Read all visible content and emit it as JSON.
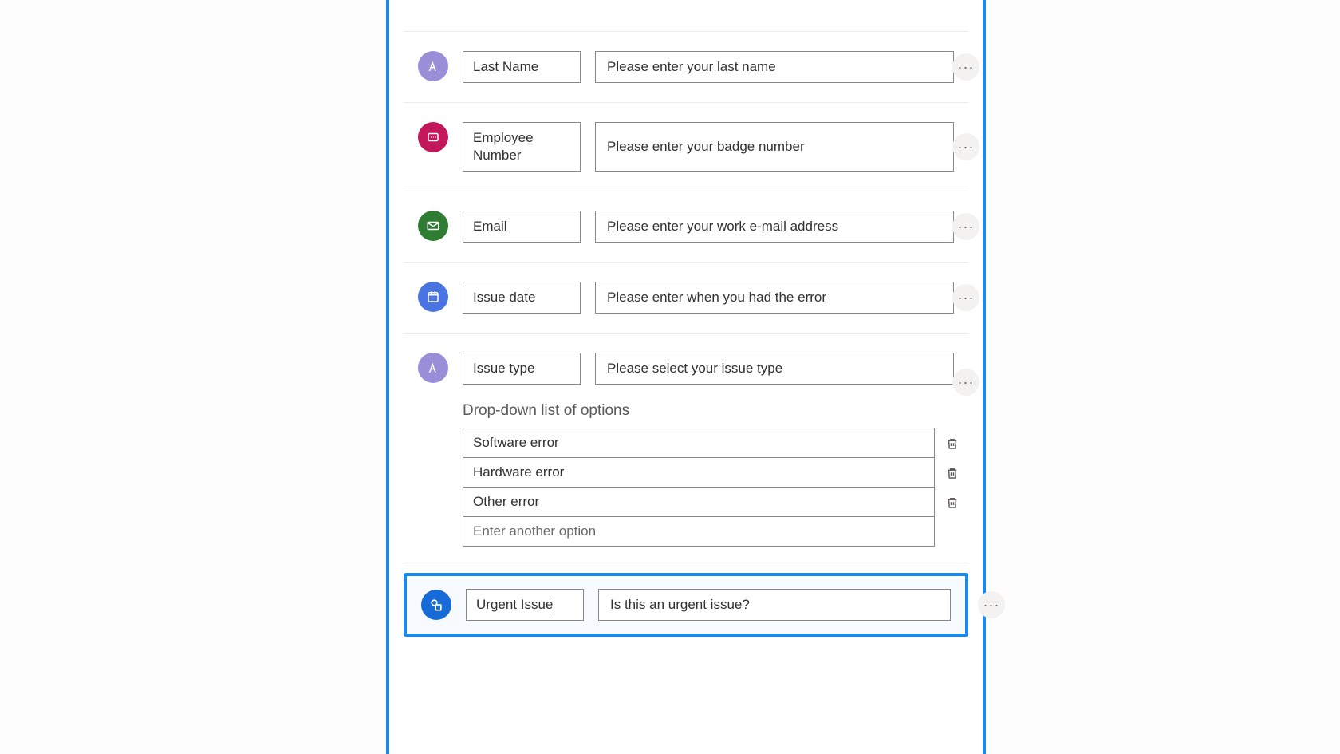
{
  "colors": {
    "text_badge": "#9b8ed8",
    "number_badge": "#c2185b",
    "email_badge": "#2e7d32",
    "date_badge": "#4a74e0",
    "toggle_badge": "#176bd6"
  },
  "fields": [
    {
      "id": "last_name",
      "type": "text",
      "label": "Last Name",
      "description": "Please enter your last name"
    },
    {
      "id": "employee_number",
      "type": "number",
      "label": "Employee Number",
      "description": "Please enter your badge number"
    },
    {
      "id": "email",
      "type": "email",
      "label": "Email",
      "description": "Please enter your work e-mail address"
    },
    {
      "id": "issue_date",
      "type": "date",
      "label": "Issue date",
      "description": "Please enter when you had the error"
    },
    {
      "id": "issue_type",
      "type": "dropdown",
      "label": "Issue type",
      "description": "Please select your issue type",
      "options_title": "Drop-down list of options",
      "options": [
        "Software error",
        "Hardware error",
        "Other error"
      ],
      "new_option_placeholder": "Enter another option"
    },
    {
      "id": "urgent_issue",
      "type": "toggle",
      "label": "Urgent Issue",
      "description": "Is this an urgent issue?",
      "selected": true
    }
  ],
  "ui": {
    "more_label": "···"
  }
}
